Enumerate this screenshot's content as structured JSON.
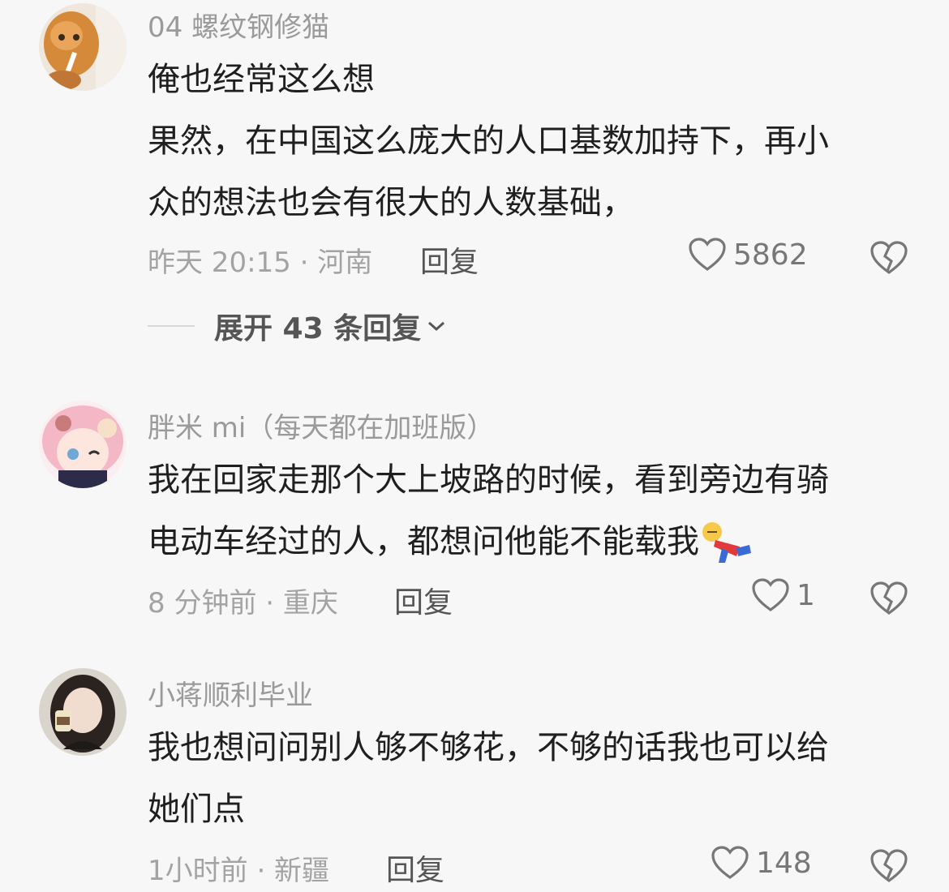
{
  "comments": [
    {
      "username": "04 螺纹钢修猫",
      "lines": [
        "俺也经常这么想",
        "果然，在中国这么庞大的人口基数加持下，再小",
        "众的想法也会有很大的人数基础，"
      ],
      "meta": "昨天 20:15 · 河南",
      "reply_label": "回复",
      "likes": "5862",
      "expand_label": "展开 43 条回复"
    },
    {
      "username": "胖米 mi（每天都在加班版）",
      "lines": [
        "我在回家走那个大上坡路的时候，看到旁边有骑",
        "电动车经过的人，都想问他能不能载我"
      ],
      "meta": "8 分钟前 · 重庆",
      "reply_label": "回复",
      "likes": "1"
    },
    {
      "username": "小蒋顺利毕业",
      "lines": [
        "我也想问问别人够不够花，不够的话我也可以给",
        "她们点"
      ],
      "meta": "1小时前 · 新疆",
      "reply_label": "回复",
      "likes": "148"
    }
  ],
  "icons": {
    "like": "heart-outline-icon",
    "dislike": "broken-heart-icon",
    "expand": "chevron-down-icon",
    "emoji": "falling-person-emoji"
  },
  "colors": {
    "background": "#f7f7f7",
    "username": "#9a9a9a",
    "text": "#1f1f1f",
    "meta": "#a3a3a3"
  }
}
